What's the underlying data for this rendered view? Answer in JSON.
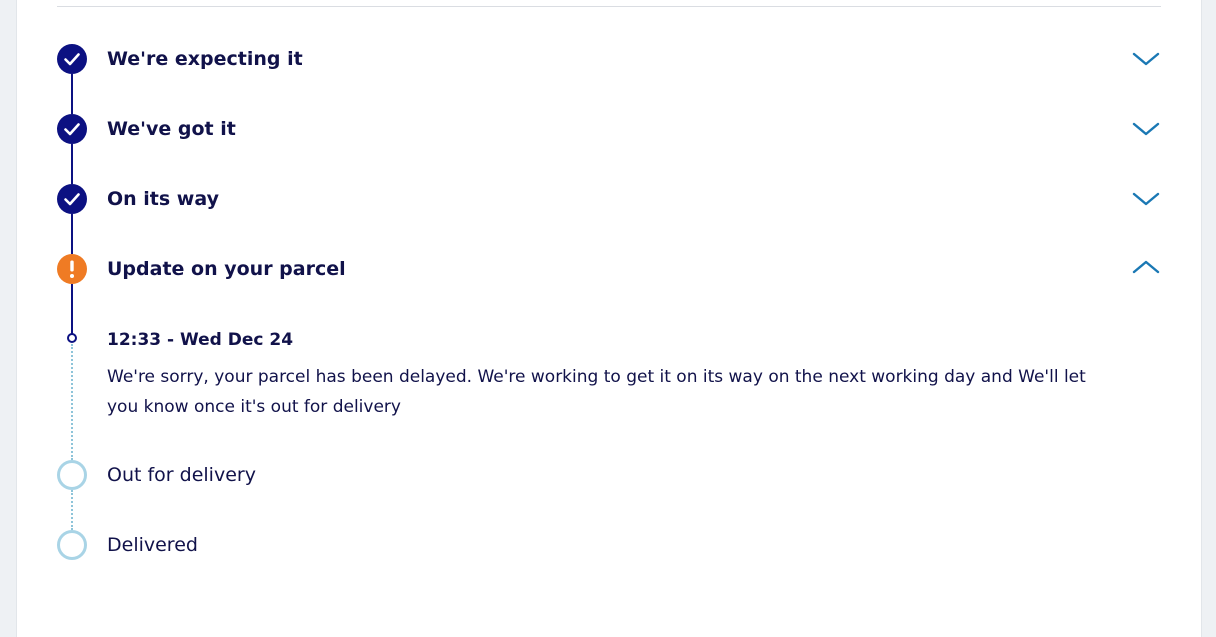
{
  "tracking": {
    "steps": [
      {
        "label": "We're expecting it",
        "status": "done",
        "expanded": false
      },
      {
        "label": "We've got it",
        "status": "done",
        "expanded": false
      },
      {
        "label": "On its way",
        "status": "done",
        "expanded": false
      },
      {
        "label": "Update on your parcel",
        "status": "alert",
        "expanded": true
      },
      {
        "label": "Out for delivery",
        "status": "pending"
      },
      {
        "label": "Delivered",
        "status": "pending"
      }
    ],
    "update_event": {
      "time": "12:33 - Wed Dec 24",
      "message": "We're sorry, your parcel has been delayed. We're working to get it on its way on the next working day and We'll let you know once it's out for delivery"
    }
  },
  "colors": {
    "done": "#0c1182",
    "alert": "#ef7b24",
    "pending_ring": "#a9d4e6",
    "chevron": "#1a78b4",
    "text": "#11124a"
  },
  "icons": {
    "done": "check-icon",
    "alert": "exclamation-icon",
    "collapsed": "chevron-down-icon",
    "expanded": "chevron-up-icon"
  }
}
